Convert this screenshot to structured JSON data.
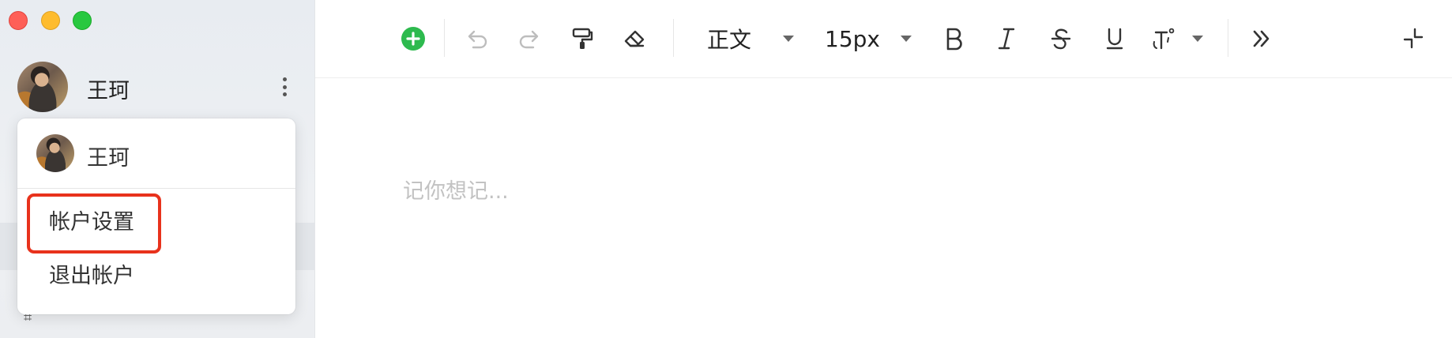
{
  "window": {
    "controls": [
      "close",
      "minimize",
      "zoom"
    ]
  },
  "user": {
    "name": "王珂"
  },
  "dropdown": {
    "name": "王珂",
    "items": [
      {
        "label": "帐户设置",
        "highlighted": true
      },
      {
        "label": "退出帐户",
        "highlighted": false
      }
    ]
  },
  "toolbar": {
    "icons": [
      "add-icon",
      "undo-icon",
      "redo-icon",
      "format-painter-icon",
      "eraser-icon",
      "bold-icon",
      "italic-icon",
      "strikethrough-icon",
      "underline-icon",
      "text-effects-icon",
      "more-chevrons-icon",
      "collapse-icon"
    ],
    "paragraph_style": "正文",
    "font_size": "15px"
  },
  "editor": {
    "placeholder": "记你想记..."
  },
  "colors": {
    "accent_green": "#2dba4e",
    "highlight_red": "#e8321c"
  }
}
